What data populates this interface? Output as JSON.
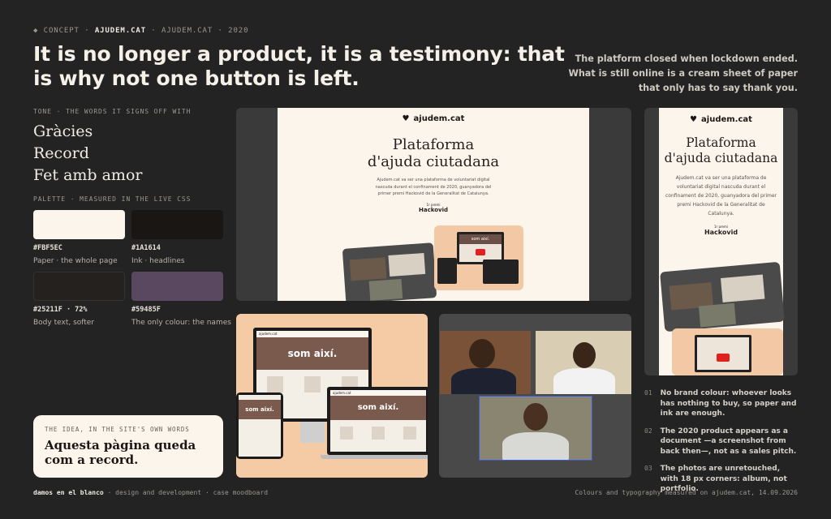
{
  "kicker": {
    "part1": "◆ CONCEPT ·",
    "part2": "AJUDEM.CAT",
    "part3": "· AJUDEM.CAT · 2020"
  },
  "headline": "It is no longer a product, it is a testimony: that is why not one button is left.",
  "sidenote": "The platform closed when lockdown ended. What is still online is a cream sheet of paper that only has to say thank you.",
  "tone": {
    "label": "TONE · THE WORDS IT SIGNS OFF WITH",
    "words": [
      "Gràcies",
      "Record",
      "Fet amb amor"
    ]
  },
  "palette": {
    "label": "PALETTE · MEASURED IN THE LIVE CSS",
    "swatches": [
      {
        "color": "#FBF5EC",
        "hex": "#FBF5EC",
        "desc": "Paper · the whole page"
      },
      {
        "color": "#1A1614",
        "hex": "#1A1614",
        "desc": "Ink · headlines"
      },
      {
        "color": "#25211F",
        "hex": "#25211F · 72%",
        "desc": "Body text, softer"
      },
      {
        "color": "#59485F",
        "hex": "#59485F",
        "desc": "The only colour: the names"
      }
    ]
  },
  "idea": {
    "label": "THE IDEA, IN THE SITE'S OWN WORDS",
    "quote": "Aquesta pàgina queda com a record."
  },
  "site": {
    "logo": "ajudem.cat",
    "title_line1": "Plataforma",
    "title_line2": "d'ajuda ciutadana",
    "body": "Ajudem.cat va ser una plataforma de voluntariat digital nascuda durant el confinament de 2020, guanyadora del primer premi Hackovid de la Generalitat de Catalunya.",
    "badge_small": "1r premi",
    "badge": "Hackovid",
    "hero": "som així."
  },
  "notes": [
    {
      "n": "01",
      "text": "No brand colour: whoever looks has nothing to buy, so paper and ink are enough."
    },
    {
      "n": "02",
      "text": "The 2020 product appears as a document —a screenshot from back then—, not as a sales pitch."
    },
    {
      "n": "03",
      "text": "The photos are unretouched, with 18 px corners: album, not portfolio."
    }
  ],
  "footer": {
    "brand": "damos en el blanco",
    "rest": "· design and development · case moodboard",
    "right": "Colours and typography measured on ajudem.cat, 14.09.2026"
  }
}
